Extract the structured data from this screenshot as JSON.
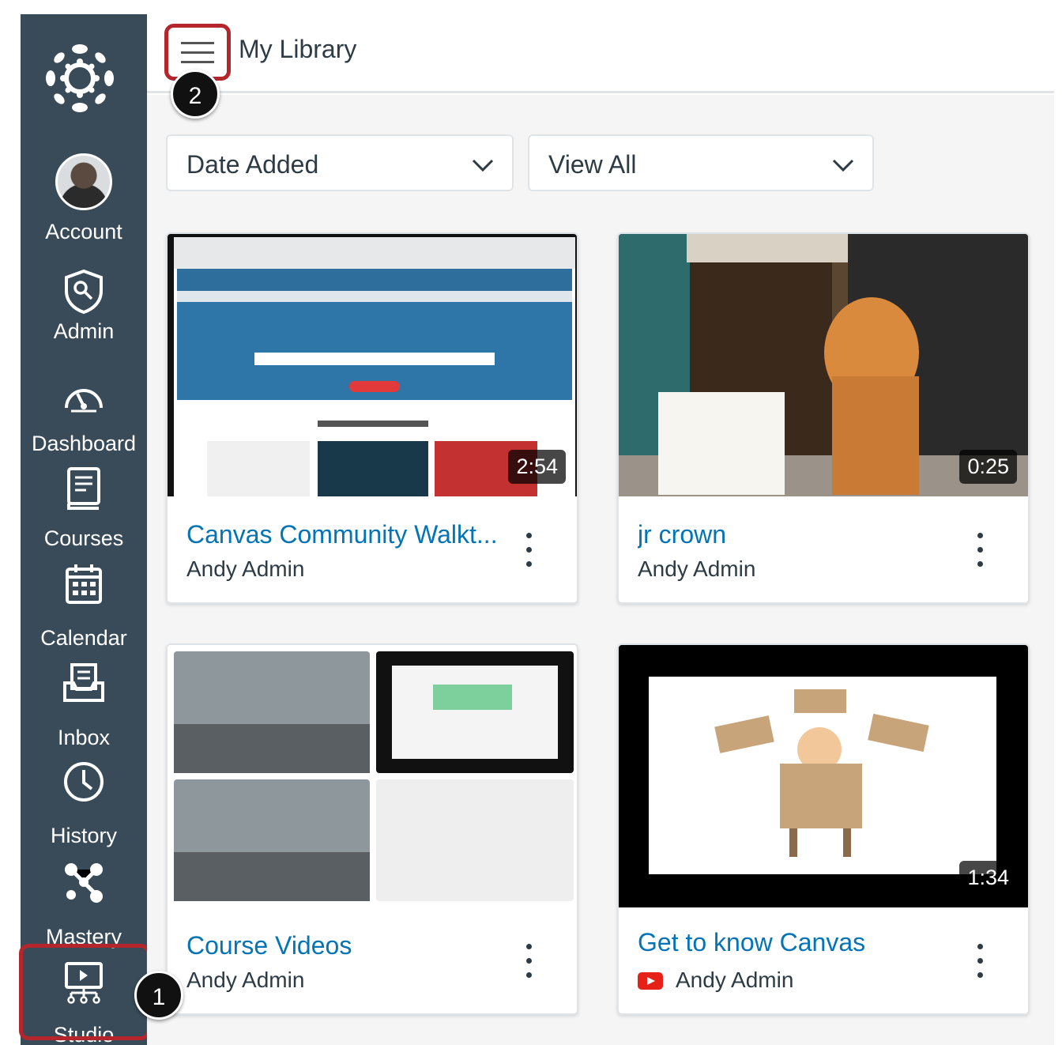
{
  "header": {
    "title": "My Library"
  },
  "nav": {
    "items": [
      {
        "label": "Account"
      },
      {
        "label": "Admin"
      },
      {
        "label": "Dashboard"
      },
      {
        "label": "Courses"
      },
      {
        "label": "Calendar"
      },
      {
        "label": "Inbox"
      },
      {
        "label": "History"
      },
      {
        "label": "Mastery"
      },
      {
        "label": "Studio"
      }
    ]
  },
  "filters": {
    "sort": {
      "value": "Date Added"
    },
    "view": {
      "value": "View All"
    }
  },
  "cards": [
    {
      "title": "Canvas Community Walkt...",
      "owner": "Andy Admin",
      "duration": "2:54"
    },
    {
      "title": "jr crown",
      "owner": "Andy Admin",
      "duration": "0:25"
    },
    {
      "title": "Course Videos",
      "owner": "Andy Admin"
    },
    {
      "title": "Get to know Canvas",
      "owner": "Andy Admin",
      "duration": "1:34"
    }
  ],
  "callouts": {
    "first": "1",
    "second": "2"
  },
  "colors": {
    "nav_bg": "#394b58",
    "link": "#0374b5",
    "highlight": "#b4262b",
    "youtube": "#e62117"
  }
}
